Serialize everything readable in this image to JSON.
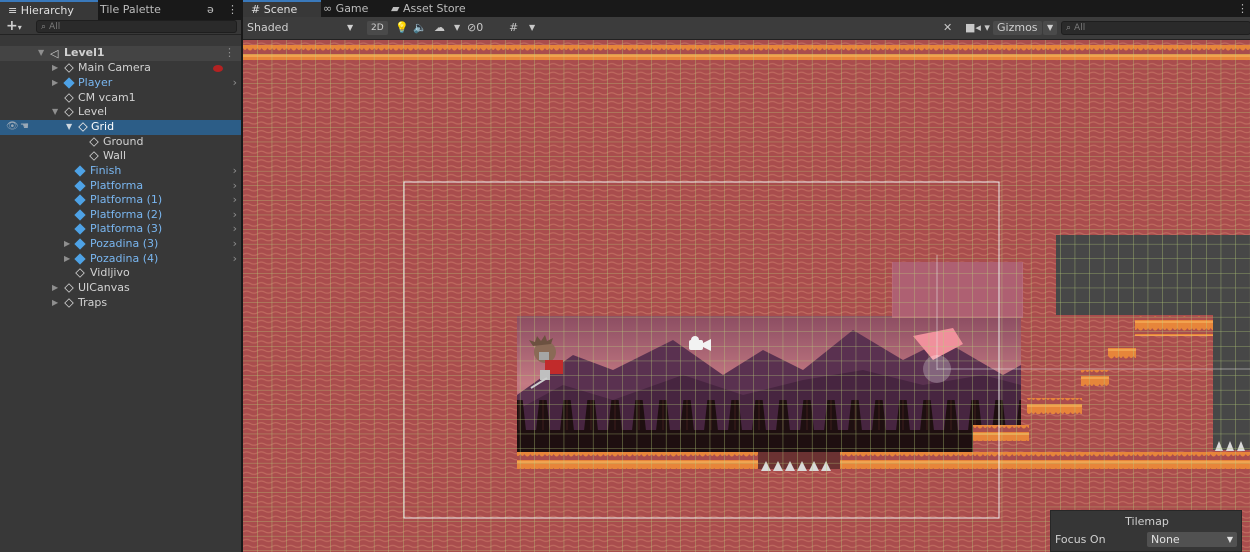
{
  "hierarchy": {
    "tabs": [
      {
        "label": "Hierarchy",
        "icon": "list-icon"
      },
      {
        "label": "Tile Palette"
      }
    ],
    "search_placeholder": "All",
    "rows": [
      {
        "label": "Level1",
        "type": "scene"
      },
      {
        "label": "Main Camera"
      },
      {
        "label": "Player",
        "type": "prefab"
      },
      {
        "label": "CM vcam1"
      },
      {
        "label": "Level"
      },
      {
        "label": "Grid",
        "selected": true
      },
      {
        "label": "Ground"
      },
      {
        "label": "Wall"
      },
      {
        "label": "Finish",
        "type": "prefab"
      },
      {
        "label": "Platforma",
        "type": "prefab"
      },
      {
        "label": "Platforma (1)",
        "type": "prefab"
      },
      {
        "label": "Platforma (2)",
        "type": "prefab"
      },
      {
        "label": "Platforma (3)",
        "type": "prefab"
      },
      {
        "label": "Pozadina (3)",
        "type": "prefab"
      },
      {
        "label": "Pozadina (4)",
        "type": "prefab"
      },
      {
        "label": "Vidljivo"
      },
      {
        "label": "UICanvas"
      },
      {
        "label": "Traps"
      }
    ]
  },
  "scene_tabs": [
    {
      "label": "Scene",
      "icon": "grid-icon"
    },
    {
      "label": "Game",
      "icon": "gamepad-icon"
    },
    {
      "label": "Asset Store",
      "icon": "bag-icon"
    }
  ],
  "scene_toolbar": {
    "shading_mode": "Shaded",
    "mode_2d": "2D",
    "hidden_count": "0",
    "gizmos_label": "Gizmos",
    "search_placeholder": "All"
  },
  "tilemap_overlay": {
    "title": "Tilemap",
    "focus_label": "Focus On",
    "focus_value": "None"
  },
  "colors": {
    "tile_red": "#a94d4d",
    "grid_line": "#b7d07a",
    "ground_orange": "#e7853a",
    "selection_blue": "#2c5d87",
    "prefab_blue": "#79b6f0"
  }
}
